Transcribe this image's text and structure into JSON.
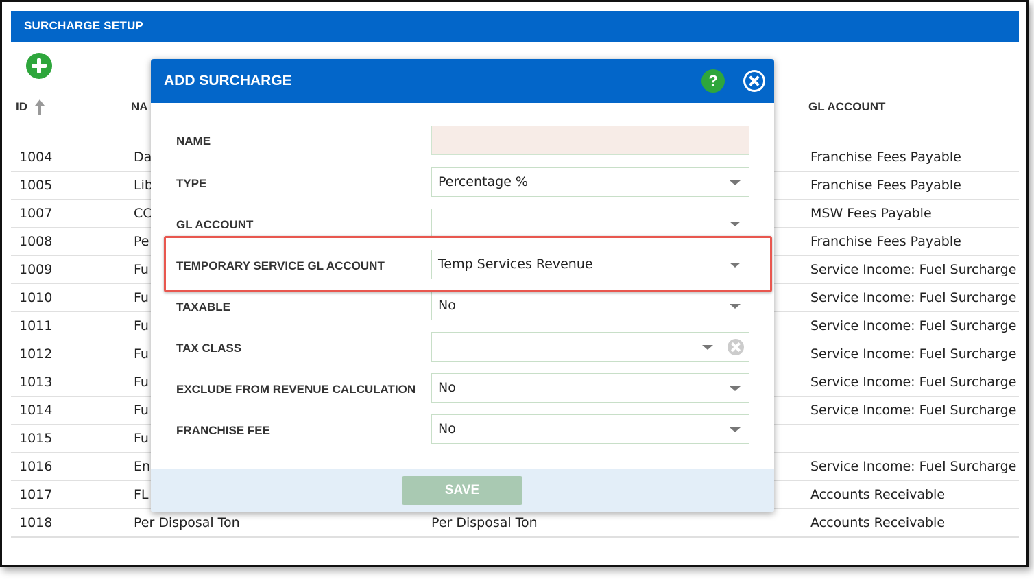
{
  "page": {
    "title": "SURCHARGE SETUP"
  },
  "table": {
    "columns": {
      "id": "ID",
      "name": "NA",
      "gl_account": "GL ACCOUNT"
    },
    "rows": [
      {
        "id": "1004",
        "name": "Da",
        "desc": "",
        "gl": "Franchise Fees Payable"
      },
      {
        "id": "1005",
        "name": "Lib",
        "desc": "",
        "gl": "Franchise Fees Payable"
      },
      {
        "id": "1007",
        "name": "CC",
        "desc": "",
        "gl": "MSW Fees Payable"
      },
      {
        "id": "1008",
        "name": "Pe",
        "desc": "",
        "gl": "Franchise Fees Payable"
      },
      {
        "id": "1009",
        "name": "Fu",
        "desc": "",
        "gl": "Service Income: Fuel Surcharge"
      },
      {
        "id": "1010",
        "name": "Fu",
        "desc": "",
        "gl": "Service Income: Fuel Surcharge"
      },
      {
        "id": "1011",
        "name": "Fu",
        "desc": "",
        "gl": "Service Income: Fuel Surcharge"
      },
      {
        "id": "1012",
        "name": "Fu",
        "desc": "",
        "gl": "Service Income: Fuel Surcharge"
      },
      {
        "id": "1013",
        "name": "Fu",
        "desc": "",
        "gl": "Service Income: Fuel Surcharge"
      },
      {
        "id": "1014",
        "name": "Fu",
        "desc": "",
        "gl": "Service Income: Fuel Surcharge"
      },
      {
        "id": "1015",
        "name": "Fu",
        "desc": "",
        "gl": ""
      },
      {
        "id": "1016",
        "name": "En",
        "desc": "",
        "gl": "Service Income: Fuel Surcharge"
      },
      {
        "id": "1017",
        "name": "FL",
        "desc": "",
        "gl": "Accounts Receivable"
      },
      {
        "id": "1018",
        "name": "Per Disposal Ton",
        "desc": "Per Disposal Ton",
        "gl": "Accounts Receivable"
      }
    ]
  },
  "modal": {
    "title": "ADD SURCHARGE",
    "help_glyph": "?",
    "fields": {
      "name": {
        "label": "NAME",
        "value": ""
      },
      "type": {
        "label": "TYPE",
        "value": "Percentage %"
      },
      "gl_account": {
        "label": "GL ACCOUNT",
        "value": ""
      },
      "temp_gl": {
        "label": "TEMPORARY SERVICE GL ACCOUNT",
        "value": "Temp Services Revenue"
      },
      "taxable": {
        "label": "TAXABLE",
        "value": "No"
      },
      "tax_class": {
        "label": "TAX CLASS",
        "value": ""
      },
      "exclude_revenue": {
        "label": "EXCLUDE FROM REVENUE CALCULATION",
        "value": "No"
      },
      "franchise_fee": {
        "label": "FRANCHISE FEE",
        "value": "No"
      }
    },
    "save_label": "SAVE"
  },
  "icons": {
    "add": "plus-circle-icon",
    "help": "help-icon",
    "close": "close-circle-icon",
    "sort": "sort-ascending-icon",
    "dropdown": "chevron-down-icon",
    "clear": "clear-icon"
  },
  "colors": {
    "brand_blue": "#0366c9",
    "add_green": "#2ea63c",
    "highlight_red": "#e8574f",
    "save_disabled": "#a9c9b2",
    "name_field_bg": "#f7ece7"
  }
}
